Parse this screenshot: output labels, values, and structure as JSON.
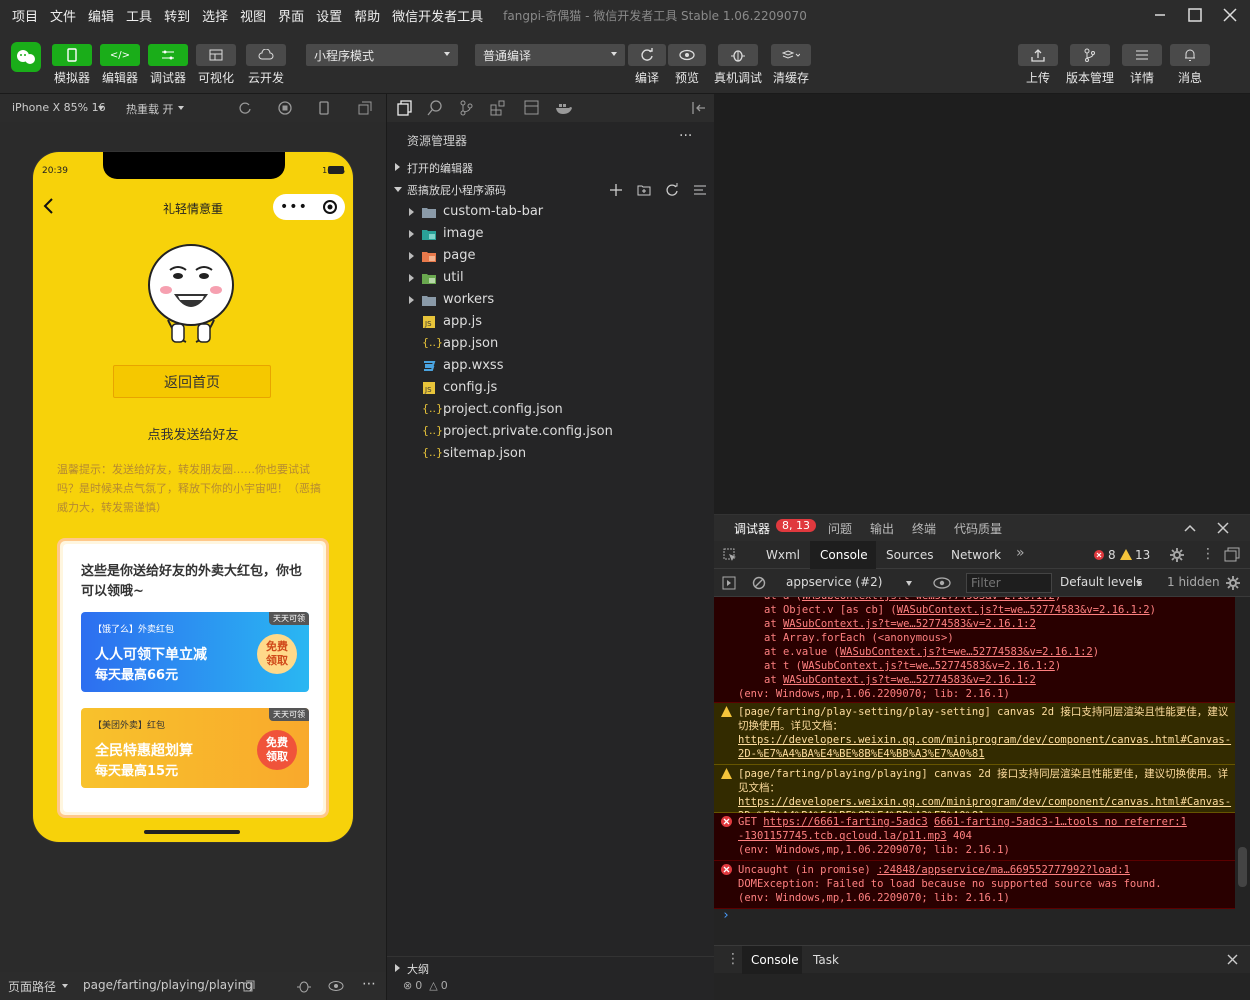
{
  "menubar": {
    "items": [
      "项目",
      "文件",
      "编辑",
      "工具",
      "转到",
      "选择",
      "视图",
      "界面",
      "设置",
      "帮助",
      "微信开发者工具"
    ],
    "title": "fangpi-奇偶猫 - 微信开发者工具 Stable 1.06.2209070"
  },
  "toolbar": {
    "left": [
      "模拟器",
      "编辑器",
      "调试器",
      "可视化",
      "云开发"
    ],
    "mode": "小程序模式",
    "compile": "普通编译",
    "mid": [
      "编译",
      "预览",
      "真机调试",
      "清缓存"
    ],
    "right": [
      "上传",
      "版本管理",
      "详情",
      "消息"
    ]
  },
  "simbar": {
    "device": "iPhone X 85% 16",
    "hotreload": "热重载 开"
  },
  "phone": {
    "time": "20:39",
    "battery": "100%",
    "nav_title": "礼轻情意重",
    "home_button": "返回首页",
    "send_friend": "点我发送给好友",
    "tip": "温馨提示：发送给好友，转发朋友圈……你也要试试吗？是时候来点气氛了，释放下你的小宇宙吧！（恶搞威力大，转发需谨慎）",
    "card_title": "这些是你送给好友的外卖大红包，你也可以领哦~",
    "coupons": [
      {
        "tag": "天天可领",
        "brand": "【饿了么】外卖红包",
        "line1": "人人可领下单立减",
        "line2": "每天最高66元",
        "circle1": "免费",
        "circle2": "领取"
      },
      {
        "tag": "天天可领",
        "brand": "【美团外卖】红包",
        "line1": "全民特惠超划算",
        "line2": "每天最高15元",
        "circle1": "免费",
        "circle2": "领取"
      }
    ]
  },
  "simfooter": {
    "label": "页面路径",
    "path": "page/farting/playing/playing"
  },
  "explorer": {
    "header": "资源管理器",
    "more": "···",
    "open_editors": "打开的编辑器",
    "project": "恶搞放屁小程序源码",
    "items": [
      {
        "name": "custom-tab-bar",
        "type": "folder"
      },
      {
        "name": "image",
        "type": "folder"
      },
      {
        "name": "page",
        "type": "folder"
      },
      {
        "name": "util",
        "type": "folder"
      },
      {
        "name": "workers",
        "type": "folder"
      },
      {
        "name": "app.js",
        "type": "js"
      },
      {
        "name": "app.json",
        "type": "json"
      },
      {
        "name": "app.wxss",
        "type": "css"
      },
      {
        "name": "config.js",
        "type": "js"
      },
      {
        "name": "project.config.json",
        "type": "json"
      },
      {
        "name": "project.private.config.json",
        "type": "json"
      },
      {
        "name": "sitemap.json",
        "type": "json"
      }
    ],
    "outline": "大纲",
    "status_err": "0",
    "status_warn": "0"
  },
  "debug": {
    "tabs": [
      "调试器",
      "问题",
      "输出",
      "终端",
      "代码质量"
    ],
    "badge": "8, 13",
    "devtabs": [
      "Wxml",
      "Console",
      "Sources",
      "Network"
    ],
    "err_count": "8",
    "warn_count": "13",
    "context": "appservice (#2)",
    "filter_placeholder": "Filter",
    "levels": "Default levels",
    "hidden": "1 hidden",
    "drawer": [
      "Console",
      "Task"
    ],
    "prompt": "›"
  },
  "colors": {
    "green": "#1aad19",
    "phone_bg": "#f7d20a",
    "error_bg": "#290000",
    "warn_bg": "#332b00"
  }
}
